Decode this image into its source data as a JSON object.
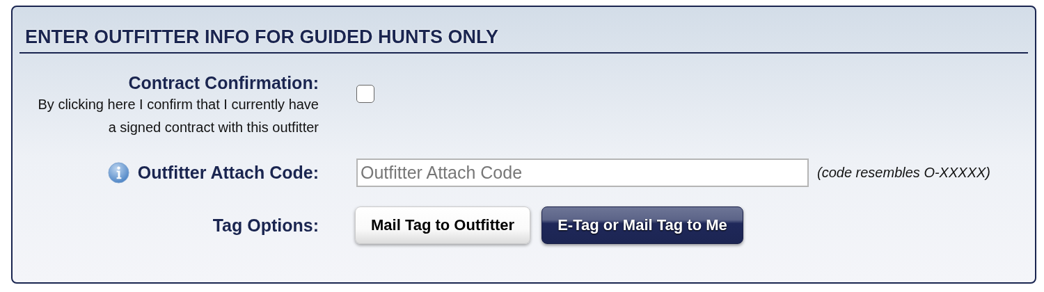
{
  "section": {
    "title": "ENTER OUTFITTER INFO FOR GUIDED HUNTS ONLY"
  },
  "contract": {
    "label": "Contract Confirmation:",
    "description": "By clicking here I confirm that I currently have a signed contract with this outfitter",
    "checked": false
  },
  "attach_code": {
    "label": "Outfitter Attach Code:",
    "placeholder": "Outfitter Attach Code",
    "hint": "(code resembles O-XXXXX)"
  },
  "tag_options": {
    "label": "Tag Options:",
    "options": [
      {
        "label": "Mail Tag to Outfitter",
        "selected": false
      },
      {
        "label": "E-Tag or Mail Tag to Me",
        "selected": true
      }
    ]
  }
}
